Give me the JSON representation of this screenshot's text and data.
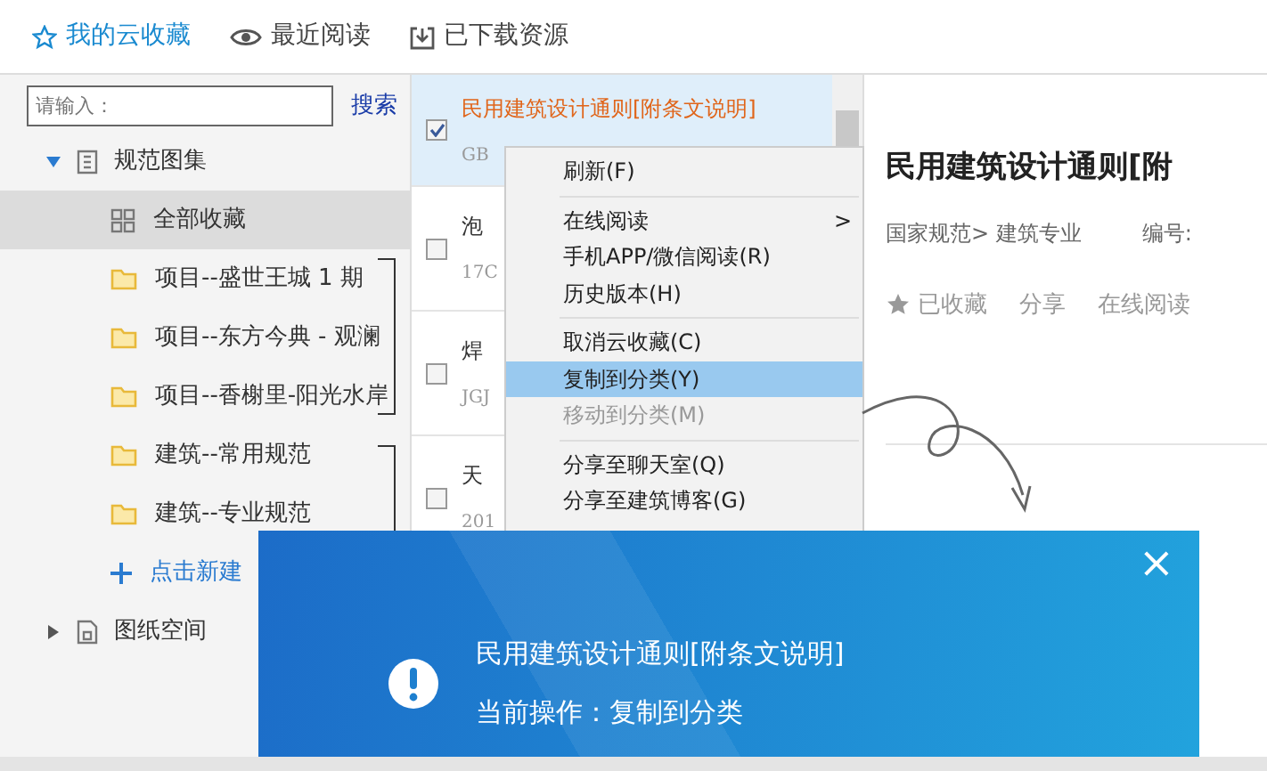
{
  "top_tabs": [
    {
      "label": "我的云收藏",
      "kind": "star",
      "selected": true
    },
    {
      "label": "最近阅读",
      "kind": "eye",
      "selected": false
    },
    {
      "label": "已下载资源",
      "kind": "download",
      "selected": false
    }
  ],
  "search": {
    "placeholder": "请输入：",
    "button": "搜索"
  },
  "sidebar": {
    "items": [
      {
        "label": "规范图集",
        "kind": "group",
        "expanded": true,
        "children": [
          {
            "label": "全部收藏",
            "kind": "all",
            "selected": true
          },
          {
            "label": "项目--盛世王城 1 期",
            "kind": "folder",
            "selected": false
          },
          {
            "label": "项目--东方今典 - 观澜",
            "kind": "folder",
            "selected": false
          },
          {
            "label": "项目--香榭里-阳光水岸",
            "kind": "folder",
            "selected": false
          },
          {
            "label": "建筑--常用规范",
            "kind": "folder",
            "selected": false
          },
          {
            "label": "建筑--专业规范",
            "kind": "folder",
            "selected": false
          },
          {
            "label": "点击新建",
            "kind": "new",
            "selected": false
          }
        ]
      },
      {
        "label": "图纸空间",
        "kind": "group",
        "expanded": false
      }
    ]
  },
  "documents": [
    {
      "title": "民用建筑设计通则[附条文说明]",
      "code": "GB",
      "checked": true,
      "selected": true
    },
    {
      "title": "泡",
      "code": "17C",
      "checked": false,
      "selected": false
    },
    {
      "title": "焊",
      "code": "JGJ",
      "checked": false,
      "selected": false
    },
    {
      "title": "天",
      "code": "201",
      "checked": false,
      "selected": false
    }
  ],
  "context_menu": [
    {
      "label": "刷新(F)",
      "selected": false,
      "disabled": false
    },
    {
      "kind": "separator"
    },
    {
      "label": "在线阅读",
      "selected": false,
      "disabled": false,
      "arrow": ">"
    },
    {
      "label": "手机APP/微信阅读(R)",
      "selected": false,
      "disabled": false
    },
    {
      "label": "历史版本(H)",
      "selected": false,
      "disabled": false
    },
    {
      "kind": "separator"
    },
    {
      "label": "取消云收藏(C)",
      "selected": false,
      "disabled": false
    },
    {
      "label": "复制到分类(Y)",
      "selected": true,
      "disabled": false
    },
    {
      "label": "移动到分类(M)",
      "selected": false,
      "disabled": true
    },
    {
      "kind": "separator"
    },
    {
      "label": "分享至聊天室(Q)",
      "selected": false,
      "disabled": false
    },
    {
      "label": "分享至建筑博客(G)",
      "selected": false,
      "disabled": false
    }
  ],
  "detail": {
    "title": "民用建筑设计通则[附",
    "breadcrumb": "国家规范> 建筑专业",
    "number_label": "编号:",
    "actions": [
      {
        "label": "已收藏",
        "kind": "star"
      },
      {
        "label": "分享"
      },
      {
        "label": "在线阅读"
      }
    ]
  },
  "notification": {
    "title": "民用建筑设计通则[附条文说明]",
    "message": "当前操作：复制到分类",
    "close": "×"
  }
}
